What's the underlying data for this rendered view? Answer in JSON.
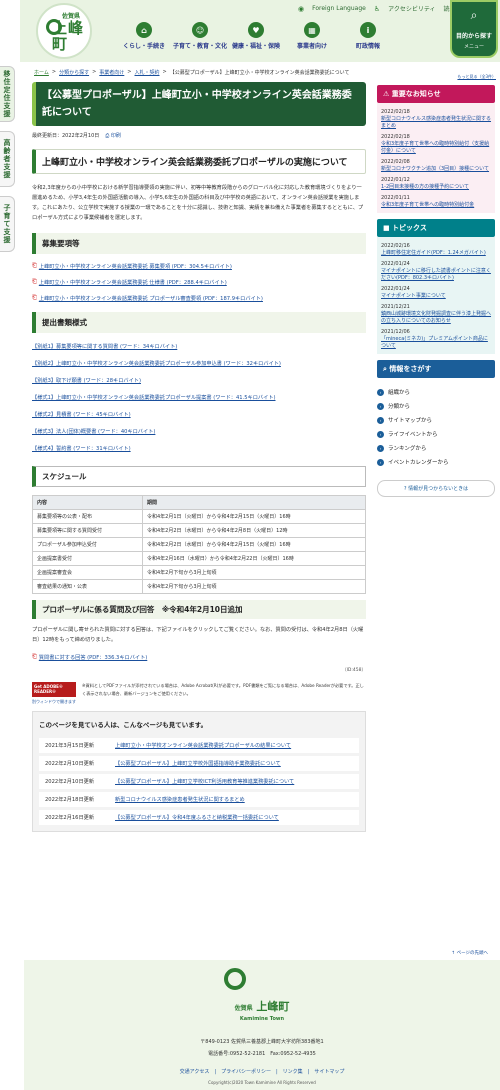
{
  "side_tabs": [
    "移住定住支援",
    "高齢者支援",
    "子育て支援"
  ],
  "header": {
    "logo_pref": "佐賀県",
    "logo_town": "上峰町",
    "util": {
      "foreign": "Foreign Language",
      "access": "アクセシビリティ",
      "read": "読み上..."
    },
    "gnav": [
      {
        "label": "くらし・手続き"
      },
      {
        "label": "子育て・教育・文化"
      },
      {
        "label": "健康・福祉・保険"
      },
      {
        "label": "事業者向け"
      },
      {
        "label": "町政情報"
      }
    ],
    "purpose": {
      "title": "目的から探す",
      "menu": "メニュー"
    }
  },
  "breadcrumb": [
    "ホーム",
    "分類から探す",
    "事業者向け",
    "入札・契約",
    "【公募型プロポーザル】上峰町立小・中学校オンライン英会話業務委託について"
  ],
  "bigger": "もっと見る（全3件）",
  "main": {
    "title": "【公募型プロポーザル】上峰町立小・中学校オンライン英会話業務委託について",
    "updated": "最終更新日：2022年2月10日",
    "print": "印刷",
    "h2": "上峰町立小・中学校オンライン英会話業務委託プロポーザルの実施について",
    "body": "令和2,3年度からの小中学校における新学習指導要領の実施に伴い、初等中等教育段階からのグローバル化に対応した教育環境づくりをより一層進めるため、小学3,4年生の外国語活動の導入、小学5,6年生の外国語の科目及び中学校の英語において、オンライン英会話授業を実施します。これにあたり、公立学校で実施する授業の一環であることを十分に認識し、技術と知識、実績を兼ね備えた事業者を募集するとともに、プロポーザル方式により事業候補者を選定します。",
    "h3_recruit": "募集要項等",
    "recruit_files": [
      "上峰町立小・中学校オンライン英会話業務委託 募集要項 (PDF：304.5キロバイト)",
      "上峰町立小・中学校オンライン英会話業務委託 仕様書 (PDF：288.4キロバイト)",
      "上峰町立小・中学校オンライン英会話業務委託 プロポーザル審査要領 (PDF：187.9キロバイト)"
    ],
    "h3_forms": "提出書類様式",
    "forms": [
      "【別紙1】募集要項等に関する質問書 (ワード：34キロバイト)",
      "【別紙2】上峰町立小・中学校オンライン英会話業務委託プロポーザル参加申込書 (ワード：32キロバイト)",
      "【別紙3】取下げ願書 (ワード：28キロバイト)",
      "【様式1】上峰町立小・中学校オンライン英会話業務委託プロポーザル提案書 (ワード：41.5キロバイト)",
      "【様式2】見積書 (ワード：45キロバイト)",
      "【様式3】法人(団体)概要書 (ワード：40キロバイト)",
      "【様式4】誓約書 (ワード：31キロバイト)"
    ],
    "h3_schedule": "スケジュール",
    "schedule_head": [
      "内容",
      "期間"
    ],
    "schedule": [
      [
        "募集要項等の公表・配布",
        "令和4年2月1日（火曜日）から令和4年2月15日（火曜日）16時"
      ],
      [
        "募集要項等に関する質問受付",
        "令和4年2月2日（水曜日）から令和4年2月8日（火曜日）12時"
      ],
      [
        "プロポーザル参加申込受付",
        "令和4年2月2日（水曜日）から令和4年2月15日（火曜日）16時"
      ],
      [
        "企画提案書受付",
        "令和4年2月16日（水曜日）から令和4年2月22日（火曜日）16時"
      ],
      [
        "企画提案審査会",
        "令和4年2月下旬から3月上旬頃"
      ],
      [
        "審査結果の通知・公表",
        "令和4年2月下旬から3月上旬頃"
      ]
    ],
    "h3_qa": "プロポーザルに係る質問及び回答　※令和4年2月10日追加",
    "qa_text": "プロポーザルに関し寄せられた質問に対する回答は、下記ファイルをクリックしてご覧ください。なお、質問の受付は、令和4年2月8日（火曜日）12時をもって締め切りました。",
    "qa_file": "質問書に対する回答 (PDF：336.3キロバイト)",
    "id": "（ID:458）",
    "acro_badge": "Get ADOBE® READER®",
    "acro_dl": "別ウィンドウで開きます",
    "acro_text": "※資料としてPDFファイルが添付されている場合は、Adobe Acrobat(R)が必要です。PDF書類をご覧になる場合は、Adobe Readerが必要です。正しく表示されない場合、最新バージョンをご使用ください。",
    "also_title": "このページを見ている人は、こんなページも見ています。",
    "also": [
      {
        "date": "2021年3月15日更新",
        "title": "上峰町立小・中学校オンライン英会話業務委託プロポーザルの結果について"
      },
      {
        "date": "2022年2月10日更新",
        "title": "【公募型プロポーザル】上峰町立学校外国語指導助手業務委託について"
      },
      {
        "date": "2022年2月10日更新",
        "title": "【公募型プロポーザル】上峰町立学校ICT利活用教育等推進業務委託について"
      },
      {
        "date": "2022年2月18日更新",
        "title": "新型コロナウイルス感染症患者発生状況に関するまとめ"
      },
      {
        "date": "2022年2月16日更新",
        "title": "【公募型プロポーザル】令和4年度ふるさと納税業務一括委託について"
      }
    ]
  },
  "aside": {
    "notice_title": "重要なお知らせ",
    "notices": [
      {
        "date": "2022/02/18",
        "text": "新型コロナウイルス感染症患者発生状況に関するまとめ"
      },
      {
        "date": "2022/02/18",
        "text": "令和3年度子育て世帯への臨時特別給付（支援給付金）について"
      },
      {
        "date": "2022/02/08",
        "text": "新型コロナワクチン追加（3回目）接種について"
      },
      {
        "date": "2022/01/12",
        "text": "1-2回目未接種の方の接種予約について"
      },
      {
        "date": "2022/01/11",
        "text": "令和3年度子育て世帯への臨時特別給付金"
      }
    ],
    "topics_title": "トピックス",
    "topics": [
      {
        "date": "2022/02/16",
        "text": "上峰町移住定住ガイド(PDF：1.24メガバイト)"
      },
      {
        "date": "2022/01/24",
        "text": "マイナポイントに移行した読書ポイントに注意ください(PDF：802.3キロバイト)"
      },
      {
        "date": "2022/01/24",
        "text": "マイナポイント事業について"
      },
      {
        "date": "2021/12/21",
        "text": "鎮西山城跡環境文化財発掘調査に伴う漆上発掘への立ち入りについてのお知らせ"
      },
      {
        "date": "2021/12/06",
        "text": "「mineca(ミネカ)」プレミアムポイント商品について"
      }
    ],
    "find_title": "情報をさがす",
    "find": [
      "組織から",
      "分類から",
      "サイトマップから",
      "ライフイベントから",
      "ランキングから",
      "イベントカレンダーから"
    ],
    "nofind": "情報が見つからないときは"
  },
  "pagetop": "ページの先頭へ",
  "footer": {
    "pref": "佐賀県",
    "town": "上峰町",
    "en": "Kamimine Town",
    "addr": "〒849-0123 佐賀県三養基郡上峰町大字坊所383番地1",
    "tel": "電話番号:0952-52-2181　Fax:0952-52-4935",
    "links": "交通アクセス　|　プライバシーポリシー　|　リンク集　|　サイトマップ",
    "copy": "Copyright(c)2020 Town Kamimine All Rights Reserved"
  },
  "colors": {
    "green": "#2e7d32",
    "notice": "#c2185b",
    "topics": "#00808a",
    "find": "#1b5e99"
  }
}
